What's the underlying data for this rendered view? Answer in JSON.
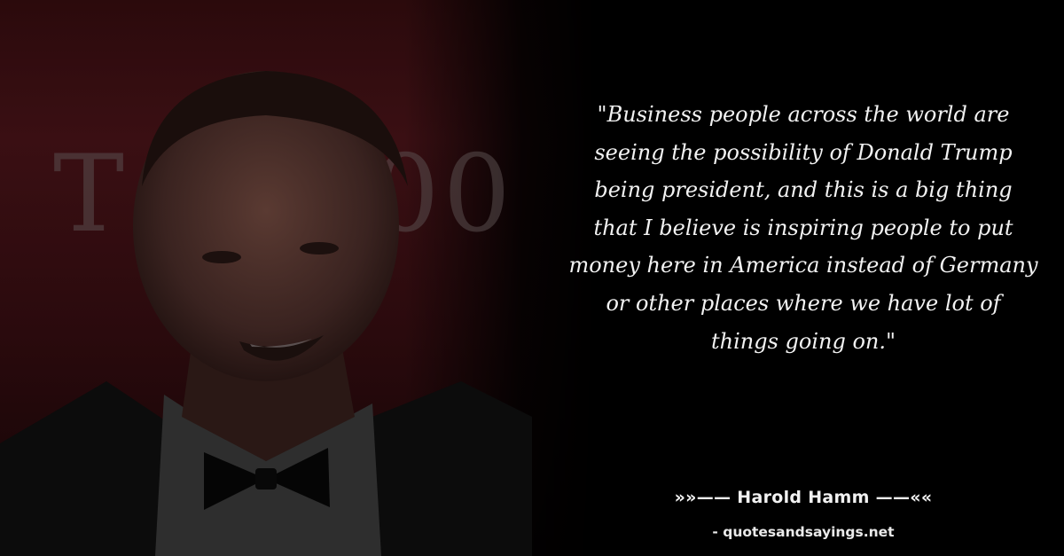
{
  "quote": {
    "lines": [
      "\"Business people across the world are",
      "seeing the possibility of Donald Trump",
      "being president, and this is a big thing",
      "that I believe is inspiring people to put",
      "money here in America instead of Germany",
      "or other places where we have lot of",
      "things going on.\""
    ]
  },
  "author": {
    "label": "»»—— Harold Hamm ——««"
  },
  "source": {
    "label": "- quotesandsayings.net"
  },
  "background": {
    "letters": [
      "T",
      "00"
    ]
  },
  "colors": {
    "background": "#000000",
    "text": "#f2f2f2",
    "photo_tint": "#3a0f13"
  }
}
